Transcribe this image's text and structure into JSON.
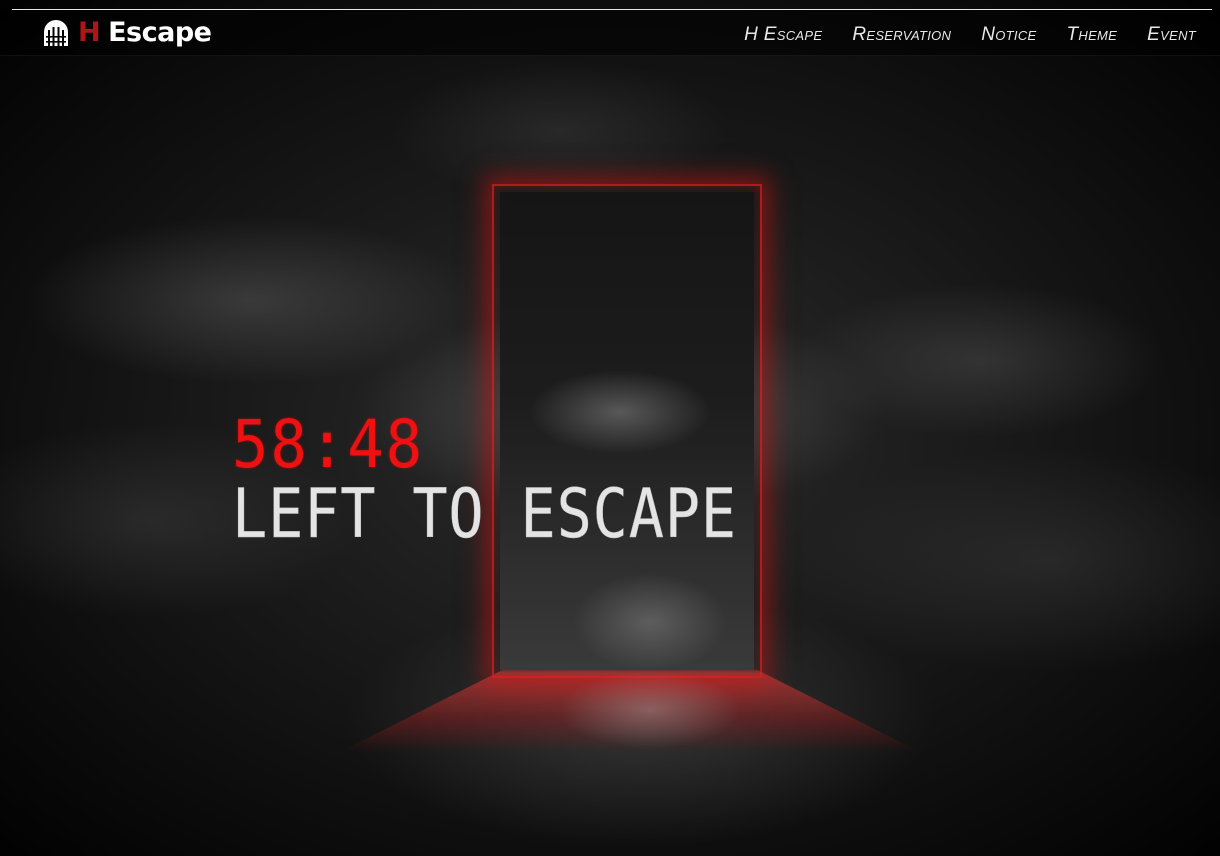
{
  "brand": {
    "prefix": "H",
    "name": "Escape",
    "logo_icon": "gate-icon",
    "accent_color": "#b01414"
  },
  "nav": {
    "items": [
      {
        "label": "H Escape"
      },
      {
        "label": "Reservation"
      },
      {
        "label": "Notice"
      },
      {
        "label": "Theme"
      },
      {
        "label": "Event"
      }
    ]
  },
  "hero": {
    "timer": "58:48",
    "tagline": "LEFT TO ESCAPE",
    "timer_color": "#ee1111",
    "door_glow_color": "#d01e1e"
  }
}
